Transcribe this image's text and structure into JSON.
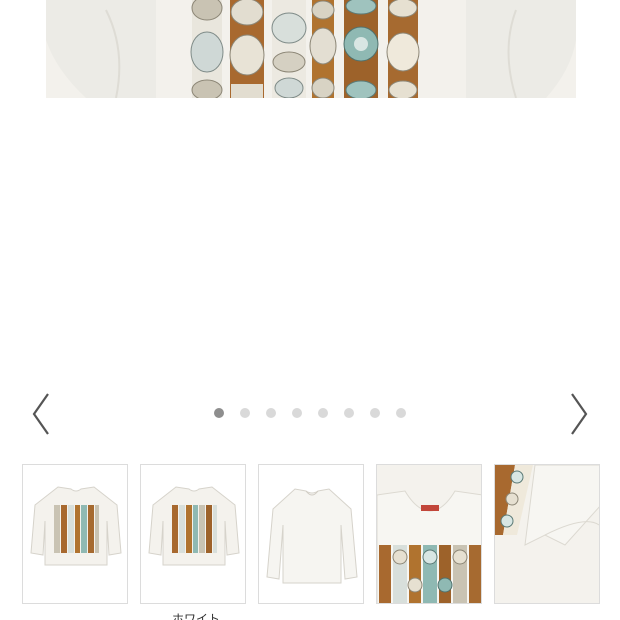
{
  "gallery": {
    "main_image": {
      "icon": "shirt-concho-belt-print-image"
    },
    "controls": {
      "prev_icon": "chevron-left-icon",
      "next_icon": "chevron-right-icon"
    },
    "dots": {
      "total": 8,
      "active_index": 0
    },
    "thumbnails": [
      {
        "name": "thumb-front-print"
      },
      {
        "name": "thumb-front-print-alt",
        "caption": "ホワイト"
      },
      {
        "name": "thumb-plain-back"
      },
      {
        "name": "thumb-closeup-print"
      },
      {
        "name": "thumb-sleeve-detail"
      }
    ]
  },
  "colors": {
    "accent_dot": "#8e8e8e",
    "dot": "#d9d9d9",
    "thumb_border": "#dcdcdc"
  }
}
